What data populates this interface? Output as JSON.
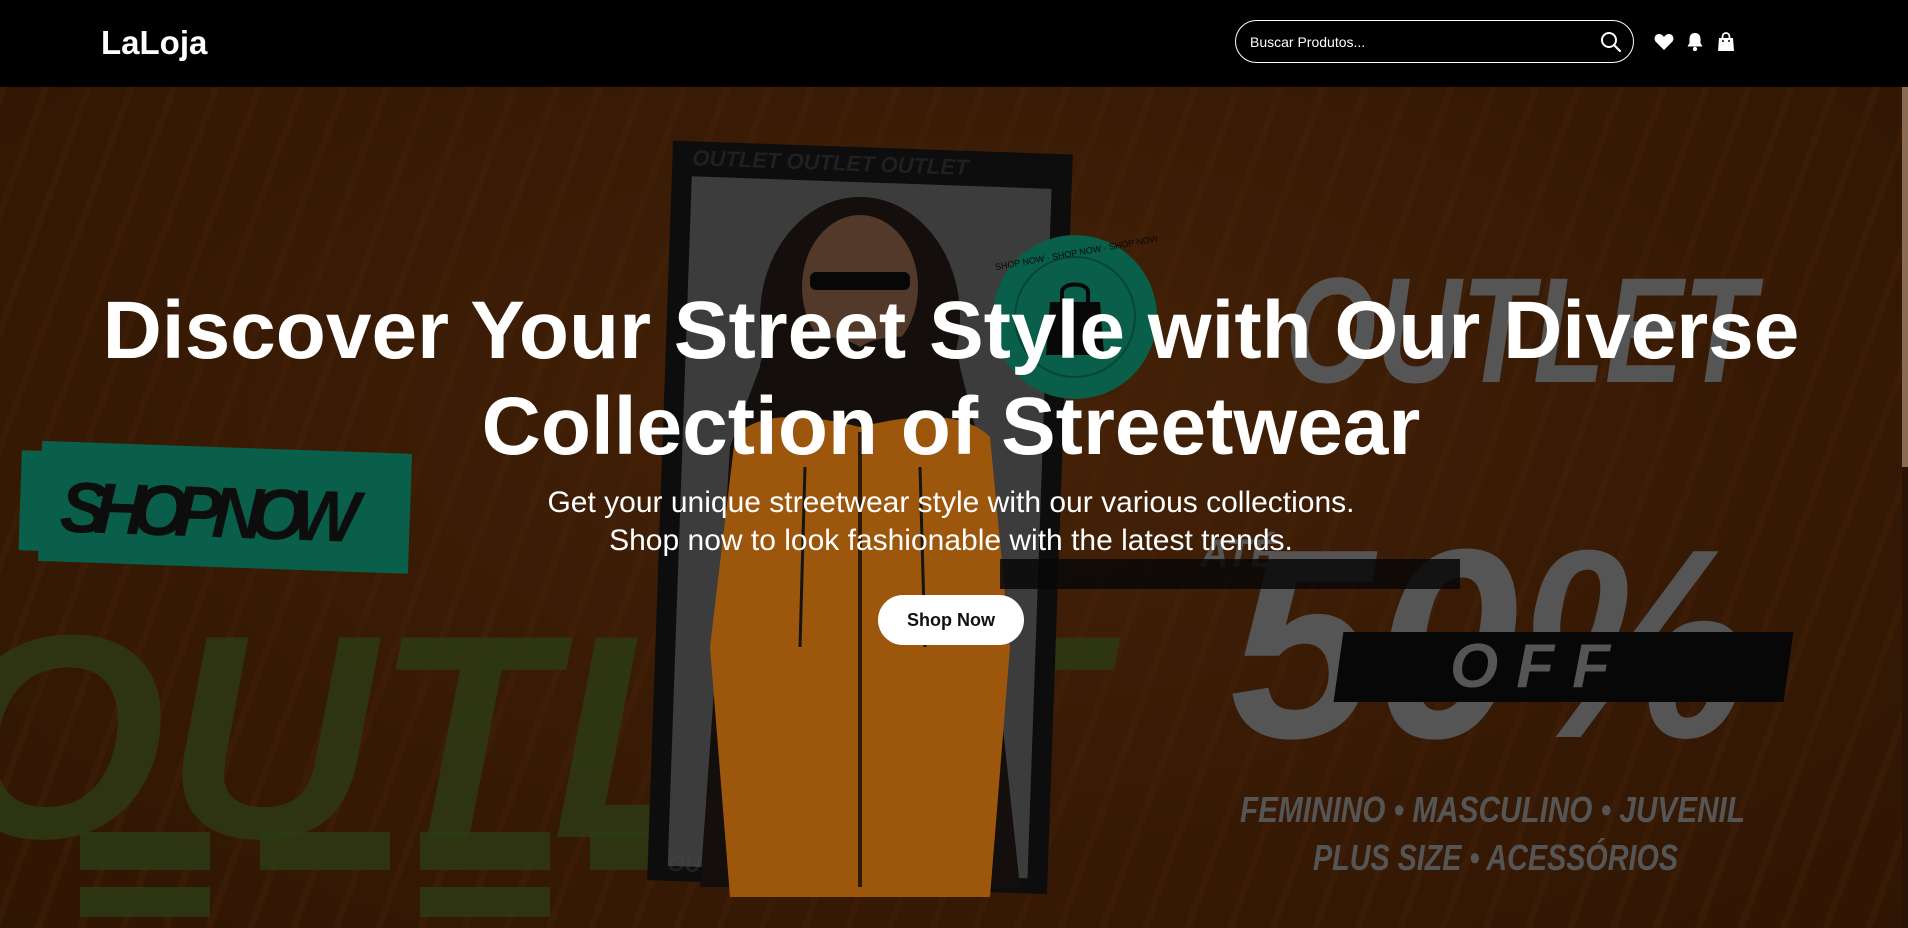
{
  "header": {
    "brand": "LaLoja",
    "search": {
      "placeholder": "Buscar Produtos..."
    },
    "icons": [
      "heart-icon",
      "bell-icon",
      "shopping-bag-icon"
    ]
  },
  "hero": {
    "title_line1": "Discover Your Street Style with Our Diverse",
    "title_line2": "Collection of Streetwear",
    "subtitle_line1": "Get your unique streetwear style with our various collections.",
    "subtitle_line2": "Shop now to look fashionable with the latest trends.",
    "cta_label": "Shop Now",
    "banner": {
      "sticker": "SHOP NOW",
      "outlet": "OUTLET",
      "badge_text": "SHOP NOW · SHOP NOW · SHOP NOW ·",
      "discount": "50%",
      "prefix": "ATÉ",
      "off": "OFF",
      "categories_line1": "FEMININO • MASCULINO • JUVENIL",
      "categories_line2": "PLUS SIZE • ACESSÓRIOS",
      "big_word": "OUTLET",
      "frame_text": "OUTLET OUTLET OUTLET"
    }
  },
  "colors": {
    "header_bg": "#000000",
    "hero_bg": "#4a2307",
    "accent_green": "#0e8a6a",
    "text": "#ffffff",
    "button_bg": "#ffffff"
  }
}
